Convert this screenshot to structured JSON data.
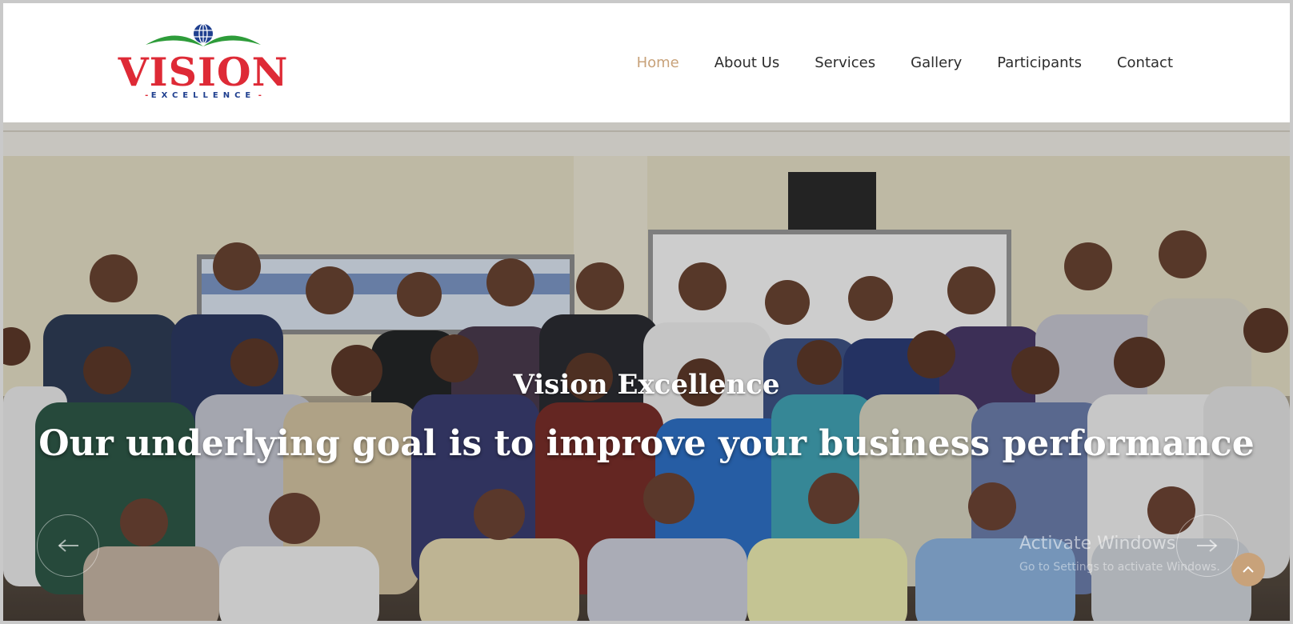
{
  "brand": {
    "name": "VISION",
    "tagline": "EXCELLENCE",
    "colors": {
      "primary": "#de2a36",
      "secondary": "#1f3f8f",
      "leaf": "#2e9c3a",
      "accent": "#c8a27a"
    }
  },
  "nav": {
    "items": [
      {
        "label": "Home",
        "active": true
      },
      {
        "label": "About Us",
        "active": false
      },
      {
        "label": "Services",
        "active": false
      },
      {
        "label": "Gallery",
        "active": false
      },
      {
        "label": "Participants",
        "active": false
      },
      {
        "label": "Contact",
        "active": false
      }
    ]
  },
  "hero": {
    "title": "Vision Excellence",
    "tagline": "Our underlying goal is to improve your business performance",
    "prev_icon": "arrow-left-icon",
    "next_icon": "arrow-right-icon"
  },
  "watermark": {
    "line1": "Activate Windows",
    "line2": "Go to Settings to activate Windows."
  },
  "scroll_top": {
    "icon": "chevron-up-icon"
  }
}
